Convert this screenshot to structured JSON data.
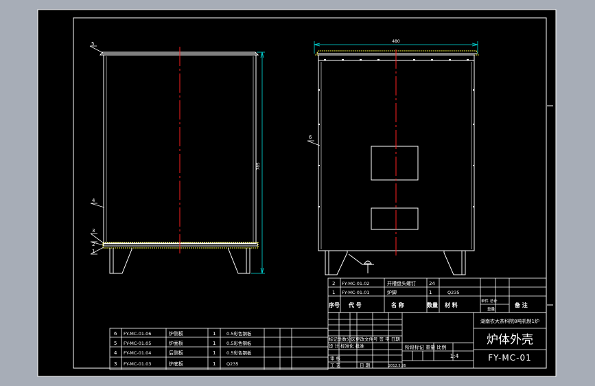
{
  "colors": {
    "background_outer": "#a7adb7",
    "sheet": "#000000",
    "outline": "#ffffff",
    "centerline": "#ff2020",
    "table_lines": "#ffffff",
    "table_text": "#ffffff",
    "dimension": "#00e0e0",
    "accent_yellow": "#ffff40"
  },
  "side_view": {
    "height_dim": "785",
    "labels": [
      "5",
      "4",
      "3",
      "2",
      "1"
    ]
  },
  "front_view": {
    "width_dim": "480",
    "label": "6"
  },
  "parts_upper": {
    "rows": [
      {
        "no": "2",
        "code": "FY-MC-01.02",
        "name": "开槽盘头螺钉",
        "qty": "24",
        "material": ""
      },
      {
        "no": "1",
        "code": "FY-MC-01.01",
        "name": "炉脚",
        "qty": "1",
        "material": "Q235"
      }
    ],
    "header": {
      "no": "序号",
      "code": "代  号",
      "name": "名  称",
      "qty": "数量",
      "material": "材  料",
      "weight": "单件 总计",
      "weight_sub": "重量",
      "remark": "备  注"
    }
  },
  "parts_lower": {
    "rows": [
      {
        "no": "6",
        "code": "FY-MC-01.06",
        "name": "炉侧板",
        "qty": "1",
        "material": "0.5彩色钢板"
      },
      {
        "no": "5",
        "code": "FY-MC-01.05",
        "name": "炉面板",
        "qty": "1",
        "material": "0.5彩色钢板"
      },
      {
        "no": "4",
        "code": "FY-MC-01.04",
        "name": "后侧板",
        "qty": "1",
        "material": "0.5彩色钢板"
      },
      {
        "no": "3",
        "code": "FY-MC-01.03",
        "name": "炉底板",
        "qty": "1",
        "material": "Q235"
      }
    ]
  },
  "title_block": {
    "company": "湖南农大茶科院8吨机制1炉",
    "title": "炉体外壳",
    "drawing_no": "FY-MC-01",
    "scale": "1:4",
    "stage_header": "阶段标记  重量  比例",
    "rev_header": "标记处数分区更改文件号 签 字 日期",
    "design_row": "设 计  标准化  批准",
    "check": "审 核",
    "process": "工 艺",
    "date_label": "日 期",
    "date_value": "2012.5.26"
  }
}
